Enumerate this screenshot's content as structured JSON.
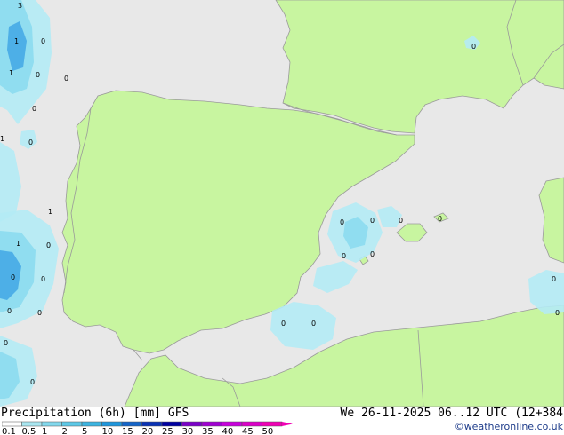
{
  "title": "Precipitation (6h) [mm] GFS",
  "valid": "We 26-11-2025 06..12 UTC (12+384",
  "credit": "©weatheronline.co.uk",
  "colors": {
    "sea": "#e8e8e8",
    "land": "#c8f5a0",
    "border": "#9a9a9a",
    "precip_light": "#b4ebf5",
    "precip_mid": "#8cdcf0",
    "precip_heavy": "#46aae6"
  },
  "scale": {
    "labels": [
      "0.1",
      "0.5",
      "1",
      "2",
      "5",
      "10",
      "15",
      "20",
      "25",
      "30",
      "35",
      "40",
      "45",
      "50"
    ],
    "colors": [
      "#ffffff",
      "#a8e6f0",
      "#82d8ec",
      "#5cc8e6",
      "#3cb4e0",
      "#1e96dc",
      "#1464c8",
      "#0a32b4",
      "#0000a0",
      "#7a00c8",
      "#a000d2",
      "#c800dc",
      "#dc00c8",
      "#f000b4"
    ]
  },
  "point_labels": [
    {
      "text": "3"
    },
    {
      "text": "0"
    },
    {
      "text": "1"
    },
    {
      "text": "1"
    },
    {
      "text": "0"
    },
    {
      "text": "0"
    },
    {
      "text": "0"
    },
    {
      "text": "0"
    },
    {
      "text": "1"
    },
    {
      "text": "1"
    },
    {
      "text": "0"
    },
    {
      "text": "1"
    },
    {
      "text": "0"
    },
    {
      "text": "0"
    },
    {
      "text": "0"
    },
    {
      "text": "0"
    },
    {
      "text": "0"
    },
    {
      "text": "0"
    },
    {
      "text": "0"
    },
    {
      "text": "0"
    },
    {
      "text": "0"
    },
    {
      "text": "0"
    },
    {
      "text": "0"
    },
    {
      "text": "0"
    },
    {
      "text": "0"
    },
    {
      "text": "0"
    },
    {
      "text": "0"
    },
    {
      "text": "0"
    },
    {
      "text": "0"
    }
  ]
}
